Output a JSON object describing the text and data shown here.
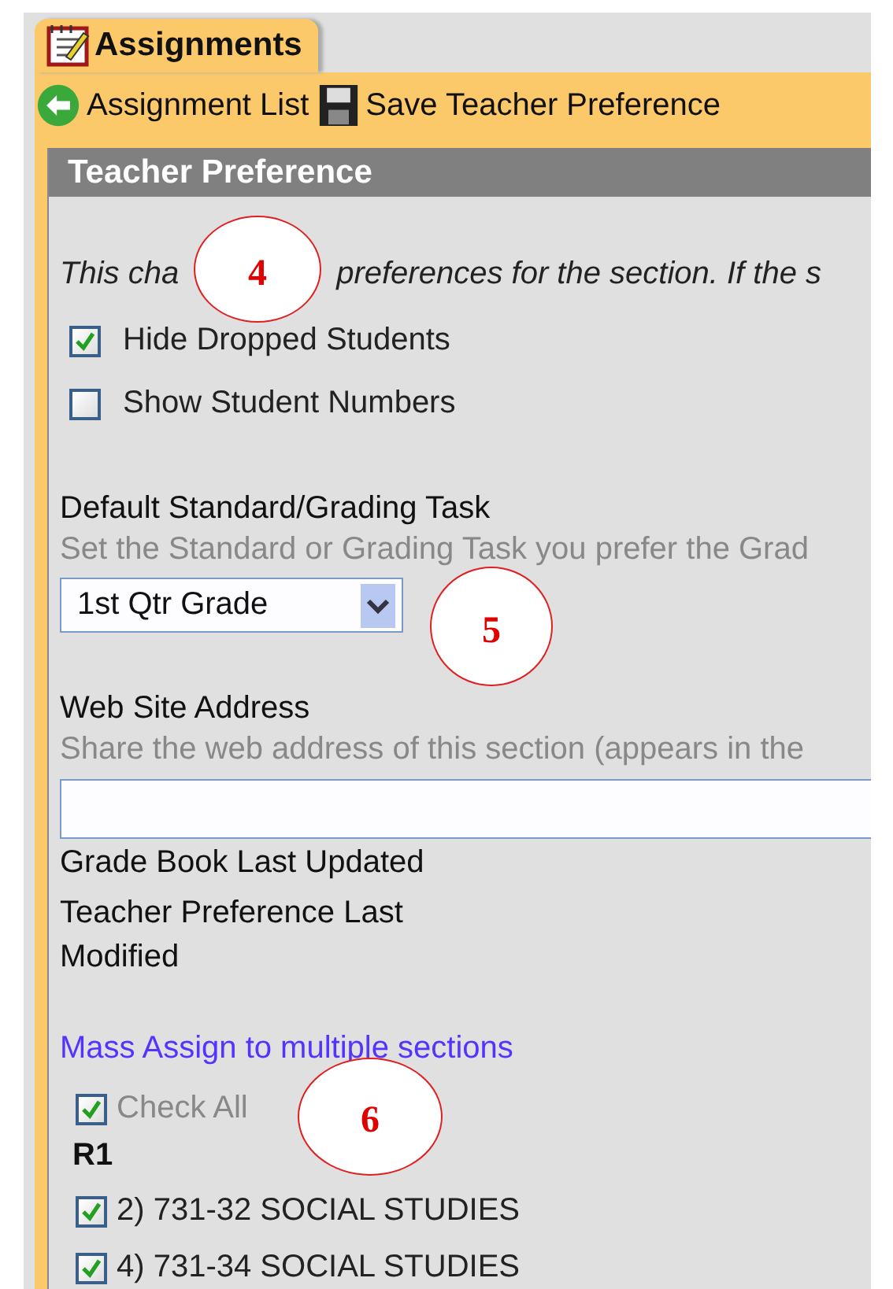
{
  "tabs": [
    {
      "label": "Assignments",
      "selected": true
    }
  ],
  "toolbar": [
    {
      "kind": "back",
      "label": "Assignment List"
    },
    {
      "kind": "save",
      "label": "Save Teacher Preference"
    }
  ],
  "panel": {
    "title": "Teacher Preference",
    "description_parts": [
      "This cha",
      "preferences for the section. If the s"
    ],
    "options": [
      {
        "label": "Hide Dropped Students",
        "checked": true
      },
      {
        "label": "Show Student Numbers",
        "checked": false
      }
    ],
    "grading_task": {
      "label": "Default Standard/Grading Task",
      "hint": "Set the Standard or Grading Task you prefer the Grad",
      "value": "1st Qtr Grade"
    },
    "web_site": {
      "label": "Web Site Address",
      "hint": "Share the web address of this section (appears in the"
    },
    "grade_book_updated": "Grade Book Last Updated",
    "preference_modified": "Teacher Preference Last Modified",
    "mass_assign": {
      "link": "Mass Assign to multiple sections",
      "check_all": {
        "label": "Check All",
        "checked": true
      },
      "group": "R1",
      "sections": [
        {
          "label": "2) 731-32 SOCIAL STUDIES",
          "checked": true
        },
        {
          "label": "4) 731-34 SOCIAL STUDIES",
          "checked": true
        }
      ]
    }
  },
  "callouts": [
    "4",
    "5",
    "6"
  ]
}
